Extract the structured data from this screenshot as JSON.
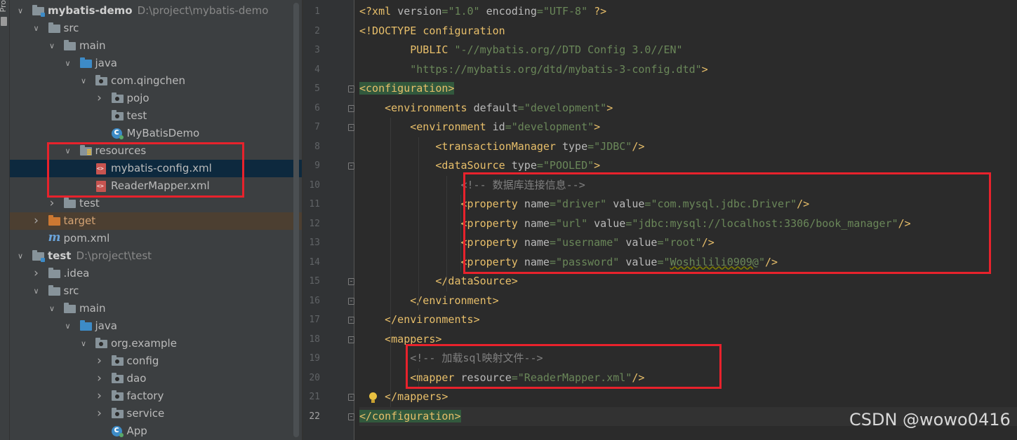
{
  "toolstrip": {
    "label": "Pro"
  },
  "project_tree": [
    {
      "type": "root",
      "name": "mybatis-demo",
      "path": "D:\\project\\mybatis-demo",
      "expanded": true
    },
    {
      "type": "folder",
      "name": "src",
      "expanded": true
    },
    {
      "type": "folder",
      "name": "main",
      "expanded": true
    },
    {
      "type": "folder",
      "name": "java",
      "expanded": true
    },
    {
      "type": "package",
      "name": "com.qingchen",
      "expanded": true
    },
    {
      "type": "package",
      "name": "pojo",
      "expanded": false
    },
    {
      "type": "package",
      "name": "test"
    },
    {
      "type": "class",
      "name": "MyBatisDemo"
    },
    {
      "type": "folder",
      "name": "resources",
      "expanded": true
    },
    {
      "type": "file",
      "name": "mybatis-config.xml",
      "selected": true
    },
    {
      "type": "file",
      "name": "ReaderMapper.xml"
    },
    {
      "type": "folder",
      "name": "test",
      "expanded": false
    },
    {
      "type": "folder",
      "name": "target",
      "expanded": false
    },
    {
      "type": "file",
      "name": "pom.xml"
    },
    {
      "type": "root",
      "name": "test",
      "path": "D:\\project\\test",
      "expanded": true
    },
    {
      "type": "folder",
      "name": ".idea",
      "expanded": false
    },
    {
      "type": "folder",
      "name": "src",
      "expanded": true
    },
    {
      "type": "folder",
      "name": "main",
      "expanded": true
    },
    {
      "type": "folder",
      "name": "java",
      "expanded": true
    },
    {
      "type": "package",
      "name": "org.example",
      "expanded": true
    },
    {
      "type": "package",
      "name": "config",
      "expanded": false
    },
    {
      "type": "package",
      "name": "dao",
      "expanded": false
    },
    {
      "type": "package",
      "name": "factory",
      "expanded": false
    },
    {
      "type": "package",
      "name": "service",
      "expanded": false
    },
    {
      "type": "class",
      "name": "App"
    }
  ],
  "editor": {
    "current_line": 22,
    "lines": [
      {
        "n": "1",
        "text": "<?xml version=\"1.0\" encoding=\"UTF-8\" ?>"
      },
      {
        "n": "2",
        "text": "<!DOCTYPE configuration"
      },
      {
        "n": "3",
        "text": "        PUBLIC \"-//mybatis.org//DTD Config 3.0//EN\""
      },
      {
        "n": "4",
        "text": "        \"https://mybatis.org/dtd/mybatis-3-config.dtd\">"
      },
      {
        "n": "5",
        "text": "<configuration>"
      },
      {
        "n": "6",
        "text": "    <environments default=\"development\">"
      },
      {
        "n": "7",
        "text": "        <environment id=\"development\">"
      },
      {
        "n": "8",
        "text": "            <transactionManager type=\"JDBC\"/>"
      },
      {
        "n": "9",
        "text": "            <dataSource type=\"POOLED\">"
      },
      {
        "n": "10",
        "text": "                <!-- 数据库连接信息-->"
      },
      {
        "n": "11",
        "text": "                <property name=\"driver\" value=\"com.mysql.jdbc.Driver\"/>"
      },
      {
        "n": "12",
        "text": "                <property name=\"url\" value=\"jdbc:mysql://localhost:3306/book_manager\"/>"
      },
      {
        "n": "13",
        "text": "                <property name=\"username\" value=\"root\"/>"
      },
      {
        "n": "14",
        "text": "                <property name=\"password\" value=\"Woshilili0909@\"/>"
      },
      {
        "n": "15",
        "text": "            </dataSource>"
      },
      {
        "n": "16",
        "text": "        </environment>"
      },
      {
        "n": "17",
        "text": "    </environments>"
      },
      {
        "n": "18",
        "text": "    <mappers>"
      },
      {
        "n": "19",
        "text": "        <!-- 加载sql映射文件-->"
      },
      {
        "n": "20",
        "text": "        <mapper resource=\"ReaderMapper.xml\"/>"
      },
      {
        "n": "21",
        "text": "    </mappers>"
      },
      {
        "n": "22",
        "text": "</configuration>"
      }
    ]
  },
  "watermark": "CSDN @wowo0416",
  "colors": {
    "annotation_box": "#e8222c",
    "tag": "#e8bf6a",
    "attribute_value": "#6a8759",
    "comment": "#808080",
    "selection": "#0d293e"
  }
}
